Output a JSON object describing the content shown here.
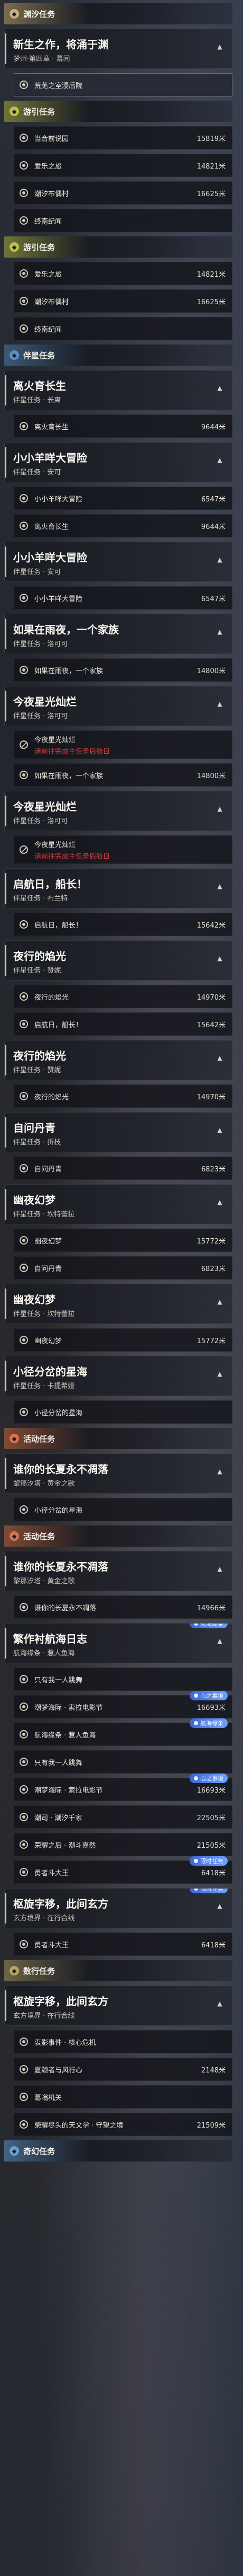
{
  "items": [
    {
      "k": "sec",
      "title": "渊汐任务",
      "color": "#c9b07a",
      "icon": "flag-icon"
    },
    {
      "k": "head",
      "title": "新生之作，将涌于渊",
      "sub": "梦州·第四章 · 幕间"
    },
    {
      "k": "row",
      "name": "荒芜之室浸后院",
      "sel": true
    },
    {
      "k": "sec",
      "title": "游引任务",
      "color": "#b9c04e",
      "icon": "compass-icon"
    },
    {
      "k": "row",
      "name": "当合前说园",
      "dist": "15819米"
    },
    {
      "k": "row",
      "name": "爱乐之旅",
      "dist": "14821米"
    },
    {
      "k": "row",
      "name": "潮汐布偶村",
      "dist": "16625米"
    },
    {
      "k": "row",
      "name": "终南纪闻"
    },
    {
      "k": "sec",
      "title": "游引任务",
      "color": "#b9c04e",
      "icon": "compass-icon"
    },
    {
      "k": "row",
      "name": "爱乐之旅",
      "dist": "14821米"
    },
    {
      "k": "row",
      "name": "潮汐布偶村",
      "dist": "16625米"
    },
    {
      "k": "row",
      "name": "终南纪闻"
    },
    {
      "k": "sec",
      "title": "伴星任务",
      "color": "#5a8fc4",
      "icon": "star-icon"
    },
    {
      "k": "head",
      "title": "离火育长生",
      "sub": "伴星任务 · 长离"
    },
    {
      "k": "row",
      "name": "离火育长生",
      "dist": "9644米"
    },
    {
      "k": "head",
      "title": "小小羊咩大冒险",
      "sub": "伴星任务 · 安可"
    },
    {
      "k": "row",
      "name": "小小羊咩大冒险",
      "dist": "6547米"
    },
    {
      "k": "row",
      "name": "离火育长生",
      "dist": "9644米"
    },
    {
      "k": "head",
      "title": "小小羊咩大冒险",
      "sub": "伴星任务 · 安可"
    },
    {
      "k": "row",
      "name": "小小羊咩大冒险",
      "dist": "6547米"
    },
    {
      "k": "head",
      "title": "如果在雨夜，一个家族",
      "sub": "伴星任务 · 洛可可"
    },
    {
      "k": "row",
      "name": "如果在雨夜，一个家族",
      "dist": "14800米"
    },
    {
      "k": "head",
      "title": "今夜星光灿烂",
      "sub": "伴星任务 · 洛可可"
    },
    {
      "k": "blk",
      "name": "今夜星光灿烂",
      "warn": "请前往完成主任务后航日"
    },
    {
      "k": "row",
      "name": "如果在雨夜，一个家族",
      "dist": "14800米"
    },
    {
      "k": "head",
      "title": "今夜星光灿烂",
      "sub": "伴星任务 · 洛可可"
    },
    {
      "k": "blk",
      "name": "今夜星光灿烂",
      "warn": "请前往完成主任务后航日"
    },
    {
      "k": "head",
      "title": "启航日，船长！",
      "sub": "伴星任务 · 布兰特"
    },
    {
      "k": "row",
      "name": "启航日，船长！",
      "dist": "15642米"
    },
    {
      "k": "head",
      "title": "夜行的焰光",
      "sub": "伴星任务 · 赞妮"
    },
    {
      "k": "row",
      "name": "夜行的焰光",
      "dist": "14970米"
    },
    {
      "k": "row",
      "name": "启航日，船长！",
      "dist": "15642米"
    },
    {
      "k": "head",
      "title": "夜行的焰光",
      "sub": "伴星任务 · 赞妮"
    },
    {
      "k": "row",
      "name": "夜行的焰光",
      "dist": "14970米"
    },
    {
      "k": "head",
      "title": "自问丹青",
      "sub": "伴星任务 · 折枝"
    },
    {
      "k": "row",
      "name": "自问丹青",
      "dist": "6823米"
    },
    {
      "k": "head",
      "title": "幽夜幻梦",
      "sub": "伴星任务 · 坎特蕾拉"
    },
    {
      "k": "row",
      "name": "幽夜幻梦",
      "dist": "15772米"
    },
    {
      "k": "row",
      "name": "自问丹青",
      "dist": "6823米"
    },
    {
      "k": "head",
      "title": "幽夜幻梦",
      "sub": "伴星任务 · 坎特蕾拉"
    },
    {
      "k": "row",
      "name": "幽夜幻梦",
      "dist": "15772米"
    },
    {
      "k": "head",
      "title": "小径分岔的星海",
      "sub": "伴星任务 · 卡提希娅"
    },
    {
      "k": "row",
      "name": "小径分岔的星海"
    },
    {
      "k": "sec",
      "title": "活动任务",
      "color": "#d8744a",
      "icon": "clock-icon"
    },
    {
      "k": "head",
      "title": "谁你的长夏永不凋落",
      "sub": "黎那汐塔 · 黄金之歌"
    },
    {
      "k": "row",
      "name": "小径分岔的星海"
    },
    {
      "k": "sec",
      "title": "活动任务",
      "color": "#d8744a",
      "icon": "clock-icon"
    },
    {
      "k": "head",
      "title": "谁你的长夏永不凋落",
      "sub": "黎那汐塔 · 黄金之歌"
    },
    {
      "k": "row",
      "name": "谁你的长夏永不凋落",
      "dist": "14966米"
    },
    {
      "k": "head",
      "title": "繁作衬航海日志",
      "sub": "航海缘条 · 惹人鱼海",
      "tag": "航海缘条"
    },
    {
      "k": "row",
      "name": "只有我一人跳舞"
    },
    {
      "k": "row",
      "name": "潮梦海际 · 索拉电影节",
      "dist": "16693米",
      "tag": "心之事境"
    },
    {
      "k": "row",
      "name": "航海缘条 · 惹人鱼海",
      "tag": "航海缘条"
    },
    {
      "k": "row",
      "name": "只有我一人跳舞"
    },
    {
      "k": "row",
      "name": "潮梦海际 · 索拉电影节",
      "dist": "16693米",
      "tag": "心之事境"
    },
    {
      "k": "row",
      "name": "潮司 · 潮汐千家",
      "dist": "22505米"
    },
    {
      "k": "row",
      "name": "荣耀之后 · 潮斗嘉然",
      "dist": "21505米"
    },
    {
      "k": "row",
      "name": "勇者斗大王",
      "dist": "6418米",
      "tag": "限时任务"
    },
    {
      "k": "head",
      "title": "枢旋字移，此间玄方",
      "sub": "玄方境界 · 在行合线",
      "tag": "限时任务"
    },
    {
      "k": "row",
      "name": "勇者斗大王",
      "dist": "6418米"
    },
    {
      "k": "sec",
      "title": "数行任务",
      "color": "#b2a46a",
      "icon": "book-icon"
    },
    {
      "k": "head",
      "title": "枢旋字移，此间玄方",
      "sub": "玄方境界 · 在行合线"
    },
    {
      "k": "row",
      "name": "衷影事件 · 核心危机"
    },
    {
      "k": "row",
      "name": "夏颂者与风行心",
      "dist": "2148米"
    },
    {
      "k": "row",
      "name": "葛嗡机关"
    },
    {
      "k": "row",
      "name": "榮耀尽头的天文学 · 守望之境",
      "dist": "21509米"
    },
    {
      "k": "sec",
      "title": "奇幻任务",
      "color": "#6b9fd8",
      "icon": "moon-icon"
    }
  ]
}
